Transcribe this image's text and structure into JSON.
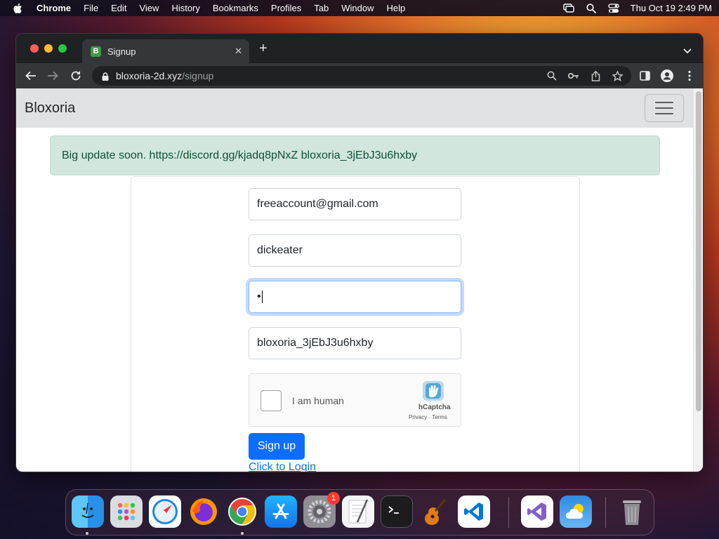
{
  "menubar": {
    "app_name": "Chrome",
    "items": [
      "File",
      "Edit",
      "View",
      "History",
      "Bookmarks",
      "Profiles",
      "Tab",
      "Window",
      "Help"
    ],
    "clock": "Thu Oct 19  2:49 PM"
  },
  "browser": {
    "tab": {
      "favicon_letter": "B",
      "title": "Signup",
      "close": "✕"
    },
    "new_tab": "+",
    "url": {
      "host": "bloxoria-2d.xyz",
      "path": "/signup"
    }
  },
  "page": {
    "brand": "Bloxoria",
    "alert": "Big update soon. https://discord.gg/kjadq8pNxZ bloxoria_3jEbJ3u6hxby",
    "form": {
      "email_value": "freeaccount@gmail.com",
      "username_value": "dickeater",
      "password_value": "•",
      "referral_value": "bloxoria_3jEbJ3u6hxby",
      "captcha_label": "I am human",
      "captcha_brand": "hCaptcha",
      "captcha_terms": "Privacy · Terms",
      "submit_label": "Sign up",
      "login_link": "Click to Login"
    }
  },
  "dock": {
    "apps": [
      "Finder",
      "Launchpad",
      "Safari",
      "Firefox",
      "Chrome",
      "App Store",
      "System Settings",
      "TextEdit",
      "Terminal",
      "GarageBand",
      "Visual Studio Code",
      "Visual Studio",
      "Weather",
      "Trash"
    ],
    "system_settings_badge": "1"
  },
  "colors": {
    "primary": "#0d6efd",
    "alert_bg": "#d1e7dd",
    "alert_text": "#0f5132",
    "navbar_bg": "#dfe2e5"
  }
}
